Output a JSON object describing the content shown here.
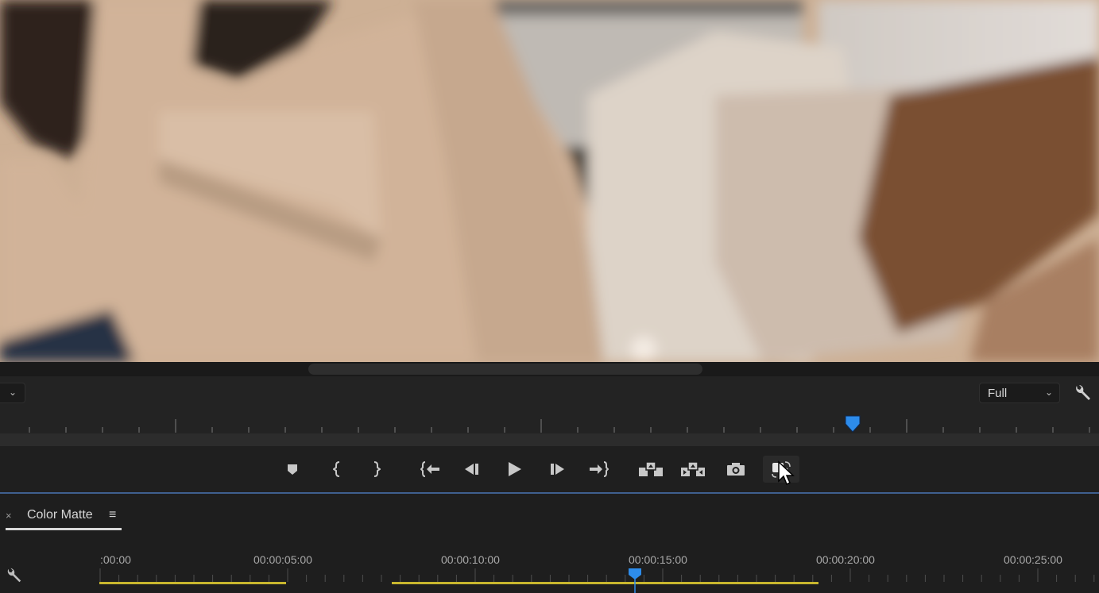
{
  "program_monitor": {
    "zoom_dropdown": {
      "icon": "chevron-down-icon"
    },
    "resolution_dropdown": {
      "value": "Full",
      "icon": "chevron-down-icon"
    },
    "settings_icon": "wrench-icon",
    "playhead_color": "#2d8ceb",
    "transport_buttons": [
      {
        "name": "add-marker-button",
        "icon": "marker-icon"
      },
      {
        "name": "mark-in-button",
        "icon": "mark-in-icon"
      },
      {
        "name": "mark-out-button",
        "icon": "mark-out-icon"
      },
      {
        "name": "go-to-in-button",
        "icon": "go-to-in-icon"
      },
      {
        "name": "step-back-button",
        "icon": "step-back-icon"
      },
      {
        "name": "play-button",
        "icon": "play-icon"
      },
      {
        "name": "step-forward-button",
        "icon": "step-forward-icon"
      },
      {
        "name": "go-to-out-button",
        "icon": "go-to-out-icon"
      },
      {
        "name": "lift-button",
        "icon": "lift-icon"
      },
      {
        "name": "extract-button",
        "icon": "extract-icon"
      },
      {
        "name": "export-frame-button",
        "icon": "camera-icon"
      },
      {
        "name": "comparison-view-button",
        "icon": "comparison-view-icon"
      }
    ]
  },
  "timeline": {
    "tab": {
      "close": "×",
      "label": "Color Matte",
      "menu": "≡"
    },
    "settings_icon": "wrench-icon",
    "timecodes": [
      ":00:00",
      "00:00:05:00",
      "00:00:10:00",
      "00:00:15:00",
      "00:00:20:00",
      "00:00:25:00"
    ],
    "playhead_timecode_approx": "00:00:14:24",
    "work_area_color": "#c8b62e",
    "playhead_color": "#2d8ceb"
  }
}
